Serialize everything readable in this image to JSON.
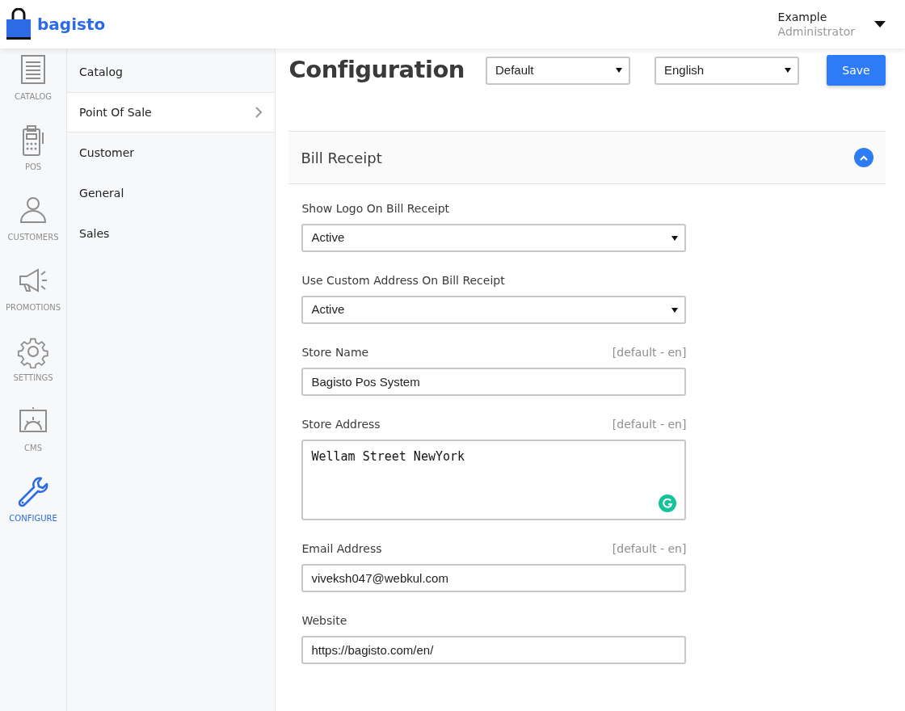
{
  "header": {
    "brand": "bagisto",
    "user": {
      "name": "Example",
      "role": "Administrator"
    }
  },
  "nav_rail": [
    {
      "label": "CATALOG",
      "selected": false
    },
    {
      "label": "POS",
      "selected": false
    },
    {
      "label": "CUSTOMERS",
      "selected": false
    },
    {
      "label": "PROMOTIONS",
      "selected": false
    },
    {
      "label": "SETTINGS",
      "selected": false
    },
    {
      "label": "CMS",
      "selected": false
    },
    {
      "label": "CONFIGURE",
      "selected": true
    }
  ],
  "config_menu": [
    {
      "label": "Catalog",
      "selected": false
    },
    {
      "label": "Point Of Sale",
      "selected": true
    },
    {
      "label": "Customer",
      "selected": false
    },
    {
      "label": "General",
      "selected": false
    },
    {
      "label": "Sales",
      "selected": false
    }
  ],
  "page": {
    "title": "Configuration",
    "channel": "Default",
    "locale": "English",
    "save_button": "Save"
  },
  "section": {
    "title": "Bill Receipt",
    "expanded": true,
    "fields": [
      {
        "kind": "select",
        "label": "Show Logo On Bill Receipt",
        "value": "Active"
      },
      {
        "kind": "select",
        "label": "Use Custom Address On Bill Receipt",
        "value": "Active"
      },
      {
        "kind": "text",
        "label": "Store Name",
        "scope": "[default - en]",
        "value": "Bagisto Pos System"
      },
      {
        "kind": "textarea",
        "label": "Store Address",
        "scope": "[default - en]",
        "value": "Wellam Street NewYork"
      },
      {
        "kind": "text",
        "label": "Email Address",
        "scope": "[default - en]",
        "value": "viveksh047@webkul.com"
      },
      {
        "kind": "text",
        "label": "Website",
        "value": "https://bagisto.com/en/"
      }
    ]
  }
}
